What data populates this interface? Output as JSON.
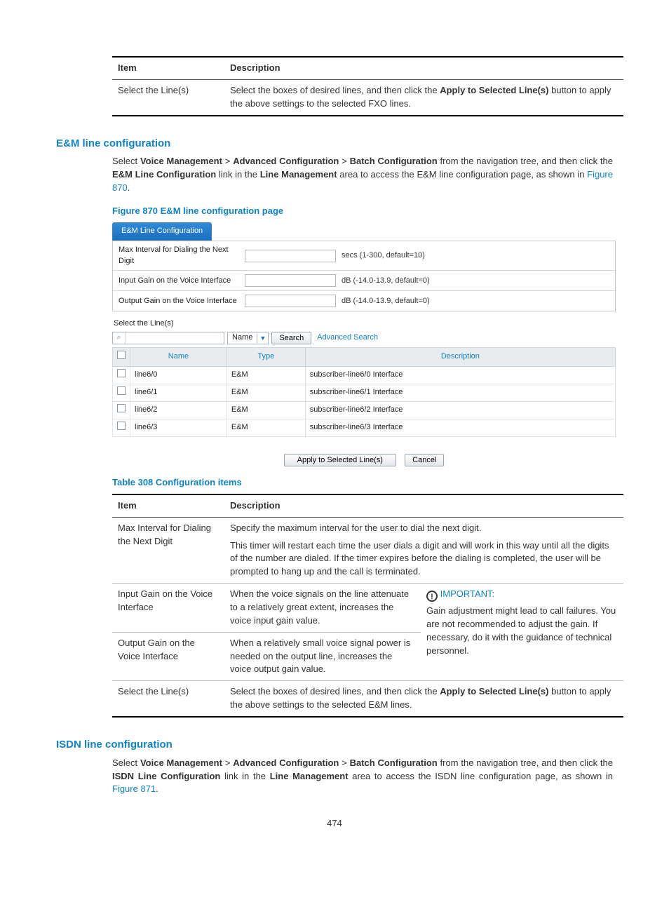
{
  "top_table": {
    "headers": {
      "item": "Item",
      "desc": "Description"
    },
    "row": {
      "item": "Select the Line(s)",
      "desc_pre": "Select the boxes of desired lines, and then click the ",
      "desc_bold": "Apply to Selected Line(s)",
      "desc_post": " button to apply the above settings to the selected FXO lines."
    }
  },
  "em": {
    "heading": "E&M line configuration",
    "nav_pre": "Select ",
    "nav_a": "Voice Management",
    "sep": " > ",
    "nav_b": "Advanced Configuration",
    "nav_c": "Batch Configuration",
    "nav_post1": " from the navigation tree, and then click the ",
    "link_bold": "E&M Line Configuration",
    "nav_post2": " link in the ",
    "area_bold": "Line Management",
    "nav_post3": " area to access the E&M line configuration page, as shown in ",
    "fig_link": "Figure 870",
    "period": ".",
    "fig_caption": "Figure 870 E&M line configuration page"
  },
  "shot": {
    "tab": "E&M Line Configuration",
    "rows": [
      {
        "label": "Max Interval for Dialing the Next Digit",
        "hint": "secs (1-300, default=10)"
      },
      {
        "label": "Input Gain on the Voice Interface",
        "hint": "dB (-14.0-13.9, default=0)"
      },
      {
        "label": "Output Gain on the Voice Interface",
        "hint": "dB (-14.0-13.9, default=0)"
      }
    ],
    "select_label": "Select the Line(s)",
    "search_dd": "Name",
    "search_btn": "Search",
    "adv": "Advanced Search",
    "cols": {
      "name": "Name",
      "type": "Type",
      "desc": "Description"
    },
    "data": [
      {
        "name": "line6/0",
        "type": "E&M",
        "desc": "subscriber-line6/0 Interface"
      },
      {
        "name": "line6/1",
        "type": "E&M",
        "desc": "subscriber-line6/1 Interface"
      },
      {
        "name": "line6/2",
        "type": "E&M",
        "desc": "subscriber-line6/2 Interface"
      },
      {
        "name": "line6/3",
        "type": "E&M",
        "desc": "subscriber-line6/3 Interface"
      }
    ],
    "apply": "Apply to Selected Line(s)",
    "cancel": "Cancel"
  },
  "t308": {
    "caption": "Table 308 Configuration items",
    "headers": {
      "item": "Item",
      "desc": "Description"
    },
    "r1": {
      "item": "Max Interval for Dialing the Next Digit",
      "p1": "Specify the maximum interval for the user to dial the next digit.",
      "p2": "This timer will restart each time the user dials a digit and will work in this way until all the digits of the number are dialed. If the timer expires before the dialing is completed, the user will be prompted to hang up and the call is terminated."
    },
    "r2": {
      "item": "Input Gain on the Voice Interface",
      "desc": "When the voice signals on the line attenuate to a relatively great extent, increases the voice input gain value."
    },
    "r3": {
      "item": "Output Gain on the Voice Interface",
      "desc": "When a relatively small voice signal power is needed on the output line, increases the voice output gain value."
    },
    "note": {
      "bang": "!",
      "head": "IMPORTANT:",
      "body": "Gain adjustment might lead to call failures. You are not recommended to adjust the gain. If necessary, do it with the guidance of technical personnel."
    },
    "r4": {
      "item": "Select the Line(s)",
      "desc_pre": "Select the boxes of desired lines, and then click the ",
      "desc_bold": "Apply to Selected Line(s)",
      "desc_post": " button to apply the above settings to the selected E&M lines."
    }
  },
  "isdn": {
    "heading": "ISDN line configuration",
    "nav_pre": "Select ",
    "nav_a": "Voice Management",
    "sep": " > ",
    "nav_b": "Advanced Configuration",
    "nav_c": "Batch Configuration",
    "nav_post1": " from the navigation tree, and then click the ",
    "link_bold": "ISDN Line Configuration",
    "nav_post2": " link in the ",
    "area_bold": "Line Management",
    "nav_post3": " area to access the ISDN line configuration page, as shown in ",
    "fig_link": "Figure 871",
    "period": "."
  },
  "pagenum": "474"
}
